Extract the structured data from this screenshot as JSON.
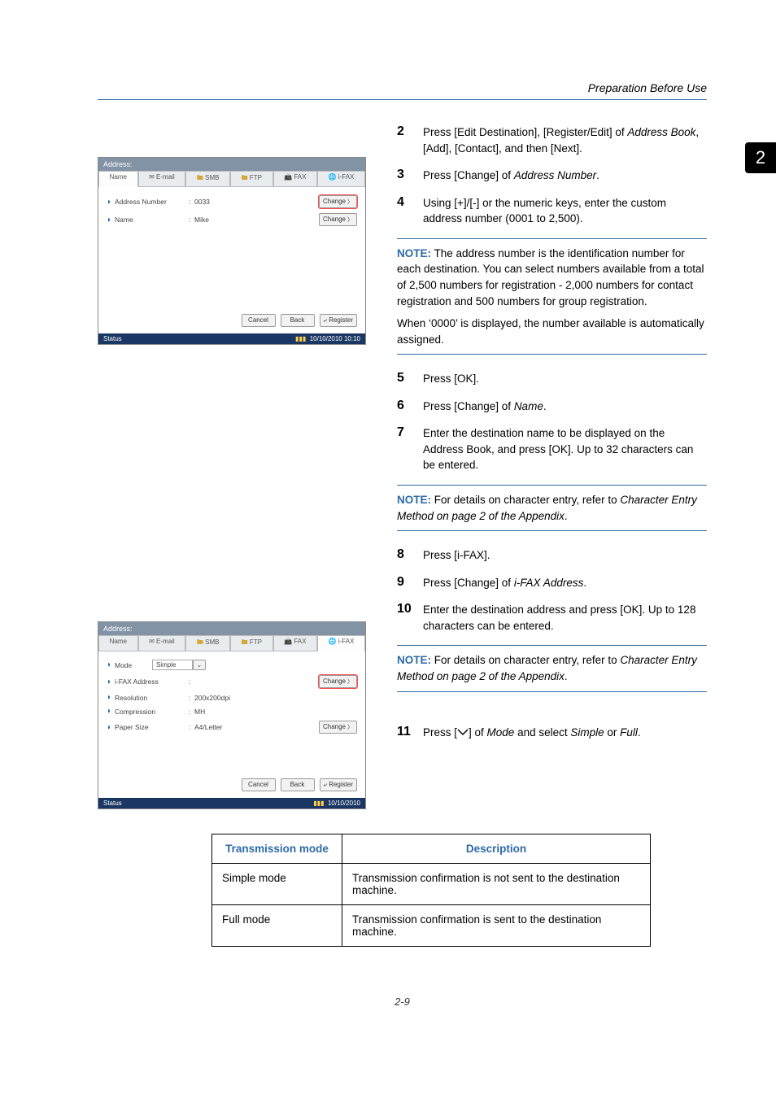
{
  "header": {
    "section_title": "Preparation Before Use"
  },
  "chapter_tab": "2",
  "screenshot1": {
    "titlebar": "Address:",
    "tabs": [
      "Name",
      "E-mail",
      "SMB",
      "FTP",
      "FAX",
      "i-FAX"
    ],
    "active_tab_index": 0,
    "rows": [
      {
        "label": "Address Number",
        "value": "0033",
        "button": "Change",
        "highlight": true
      },
      {
        "label": "Name",
        "value": "Mike",
        "button": "Change",
        "highlight": false
      }
    ],
    "footer": [
      "Cancel",
      "Back",
      "Register"
    ],
    "status_left": "Status",
    "status_right": "10/10/2010   10:10"
  },
  "screenshot2": {
    "titlebar": "Address:",
    "tabs": [
      "Name",
      "E-mail",
      "SMB",
      "FTP",
      "FAX",
      "i-FAX"
    ],
    "active_tab_index": 5,
    "rows": [
      {
        "label": "Mode",
        "dropdown": "Simple"
      },
      {
        "label": "i-FAX Address",
        "value": "",
        "button": "Change",
        "highlight": true
      },
      {
        "label": "Resolution",
        "value": "200x200dpi"
      },
      {
        "label": "Compression",
        "value": "MH"
      },
      {
        "label": "Paper Size",
        "value": "A4/Letter",
        "button": "Change",
        "highlight": false
      }
    ],
    "footer": [
      "Cancel",
      "Back",
      "Register"
    ],
    "status_left": "Status",
    "status_right": "10/10/2010"
  },
  "steps": {
    "s2": {
      "num": "2",
      "body_pre": "Press [Edit Destination], [Register/Edit] of ",
      "ital1": "Address Book",
      "body_post": ", [Add], [Contact], and then [Next]."
    },
    "s3": {
      "num": "3",
      "body_pre": "Press [Change] of ",
      "ital1": "Address Number",
      "body_post": "."
    },
    "s4": {
      "num": "4",
      "body": "Using [+]/[-] or the numeric keys, enter the custom address number (0001 to 2,500)."
    },
    "s5": {
      "num": "5",
      "body": "Press [OK]."
    },
    "s6": {
      "num": "6",
      "body_pre": "Press [Change] of ",
      "ital1": "Name",
      "body_post": "."
    },
    "s7": {
      "num": "7",
      "body": "Enter the destination name to be displayed on the Address Book, and press [OK]. Up to 32 characters can be entered."
    },
    "s8": {
      "num": "8",
      "body": "Press [i-FAX]."
    },
    "s9": {
      "num": "9",
      "body_pre": "Press [Change] of ",
      "ital1": "i-FAX Address",
      "body_post": "."
    },
    "s10": {
      "num": "10",
      "body": "Enter the destination address and press [OK]. Up to 128 characters can be entered."
    },
    "s11": {
      "num": "11",
      "body_pre": "Press [",
      "body_mid": "] of ",
      "ital1": "Mode",
      "body_mid2": " and select ",
      "ital2": "Simple",
      "body_mid3": " or ",
      "ital3": "Full",
      "body_post": "."
    }
  },
  "notes": {
    "n1": {
      "label": "NOTE:",
      "body": " The address number is the identification number for each destination. You can select numbers available from a total of 2,500 numbers for registration - 2,000 numbers for contact registration and 500 numbers for group registration.",
      "body2": "When ‘0000’ is displayed, the number available is automatically assigned."
    },
    "n2": {
      "label": "NOTE:",
      "body_pre": " For details on character entry, refer to ",
      "ital": "Character Entry Method on page 2 of the Appendix",
      "body_post": "."
    },
    "n3": {
      "label": "NOTE:",
      "body_pre": " For details on character entry, refer to ",
      "ital": "Character Entry Method on page 2 of the Appendix",
      "body_post": "."
    }
  },
  "transmission_table": {
    "headers": [
      "Transmission mode",
      "Description"
    ],
    "rows": [
      [
        "Simple mode",
        "Transmission confirmation is not sent to the destination machine."
      ],
      [
        "Full mode",
        "Transmission confirmation is sent to the destination machine."
      ]
    ]
  },
  "footer": {
    "page": "2-9"
  }
}
